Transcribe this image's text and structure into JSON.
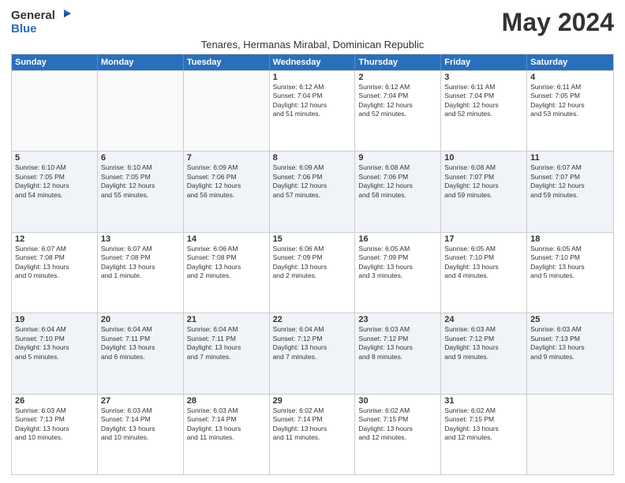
{
  "logo": {
    "general": "General",
    "blue": "Blue"
  },
  "title": "May 2024",
  "subtitle": "Tenares, Hermanas Mirabal, Dominican Republic",
  "headers": [
    "Sunday",
    "Monday",
    "Tuesday",
    "Wednesday",
    "Thursday",
    "Friday",
    "Saturday"
  ],
  "weeks": [
    [
      {
        "day": "",
        "info": ""
      },
      {
        "day": "",
        "info": ""
      },
      {
        "day": "",
        "info": ""
      },
      {
        "day": "1",
        "info": "Sunrise: 6:12 AM\nSunset: 7:04 PM\nDaylight: 12 hours\nand 51 minutes."
      },
      {
        "day": "2",
        "info": "Sunrise: 6:12 AM\nSunset: 7:04 PM\nDaylight: 12 hours\nand 52 minutes."
      },
      {
        "day": "3",
        "info": "Sunrise: 6:11 AM\nSunset: 7:04 PM\nDaylight: 12 hours\nand 52 minutes."
      },
      {
        "day": "4",
        "info": "Sunrise: 6:11 AM\nSunset: 7:05 PM\nDaylight: 12 hours\nand 53 minutes."
      }
    ],
    [
      {
        "day": "5",
        "info": "Sunrise: 6:10 AM\nSunset: 7:05 PM\nDaylight: 12 hours\nand 54 minutes."
      },
      {
        "day": "6",
        "info": "Sunrise: 6:10 AM\nSunset: 7:05 PM\nDaylight: 12 hours\nand 55 minutes."
      },
      {
        "day": "7",
        "info": "Sunrise: 6:09 AM\nSunset: 7:06 PM\nDaylight: 12 hours\nand 56 minutes."
      },
      {
        "day": "8",
        "info": "Sunrise: 6:09 AM\nSunset: 7:06 PM\nDaylight: 12 hours\nand 57 minutes."
      },
      {
        "day": "9",
        "info": "Sunrise: 6:08 AM\nSunset: 7:06 PM\nDaylight: 12 hours\nand 58 minutes."
      },
      {
        "day": "10",
        "info": "Sunrise: 6:08 AM\nSunset: 7:07 PM\nDaylight: 12 hours\nand 59 minutes."
      },
      {
        "day": "11",
        "info": "Sunrise: 6:07 AM\nSunset: 7:07 PM\nDaylight: 12 hours\nand 59 minutes."
      }
    ],
    [
      {
        "day": "12",
        "info": "Sunrise: 6:07 AM\nSunset: 7:08 PM\nDaylight: 13 hours\nand 0 minutes."
      },
      {
        "day": "13",
        "info": "Sunrise: 6:07 AM\nSunset: 7:08 PM\nDaylight: 13 hours\nand 1 minute."
      },
      {
        "day": "14",
        "info": "Sunrise: 6:06 AM\nSunset: 7:08 PM\nDaylight: 13 hours\nand 2 minutes."
      },
      {
        "day": "15",
        "info": "Sunrise: 6:06 AM\nSunset: 7:09 PM\nDaylight: 13 hours\nand 2 minutes."
      },
      {
        "day": "16",
        "info": "Sunrise: 6:05 AM\nSunset: 7:09 PM\nDaylight: 13 hours\nand 3 minutes."
      },
      {
        "day": "17",
        "info": "Sunrise: 6:05 AM\nSunset: 7:10 PM\nDaylight: 13 hours\nand 4 minutes."
      },
      {
        "day": "18",
        "info": "Sunrise: 6:05 AM\nSunset: 7:10 PM\nDaylight: 13 hours\nand 5 minutes."
      }
    ],
    [
      {
        "day": "19",
        "info": "Sunrise: 6:04 AM\nSunset: 7:10 PM\nDaylight: 13 hours\nand 5 minutes."
      },
      {
        "day": "20",
        "info": "Sunrise: 6:04 AM\nSunset: 7:11 PM\nDaylight: 13 hours\nand 6 minutes."
      },
      {
        "day": "21",
        "info": "Sunrise: 6:04 AM\nSunset: 7:11 PM\nDaylight: 13 hours\nand 7 minutes."
      },
      {
        "day": "22",
        "info": "Sunrise: 6:04 AM\nSunset: 7:12 PM\nDaylight: 13 hours\nand 7 minutes."
      },
      {
        "day": "23",
        "info": "Sunrise: 6:03 AM\nSunset: 7:12 PM\nDaylight: 13 hours\nand 8 minutes."
      },
      {
        "day": "24",
        "info": "Sunrise: 6:03 AM\nSunset: 7:12 PM\nDaylight: 13 hours\nand 9 minutes."
      },
      {
        "day": "25",
        "info": "Sunrise: 6:03 AM\nSunset: 7:13 PM\nDaylight: 13 hours\nand 9 minutes."
      }
    ],
    [
      {
        "day": "26",
        "info": "Sunrise: 6:03 AM\nSunset: 7:13 PM\nDaylight: 13 hours\nand 10 minutes."
      },
      {
        "day": "27",
        "info": "Sunrise: 6:03 AM\nSunset: 7:14 PM\nDaylight: 13 hours\nand 10 minutes."
      },
      {
        "day": "28",
        "info": "Sunrise: 6:03 AM\nSunset: 7:14 PM\nDaylight: 13 hours\nand 11 minutes."
      },
      {
        "day": "29",
        "info": "Sunrise: 6:02 AM\nSunset: 7:14 PM\nDaylight: 13 hours\nand 11 minutes."
      },
      {
        "day": "30",
        "info": "Sunrise: 6:02 AM\nSunset: 7:15 PM\nDaylight: 13 hours\nand 12 minutes."
      },
      {
        "day": "31",
        "info": "Sunrise: 6:02 AM\nSunset: 7:15 PM\nDaylight: 13 hours\nand 12 minutes."
      },
      {
        "day": "",
        "info": ""
      }
    ]
  ]
}
